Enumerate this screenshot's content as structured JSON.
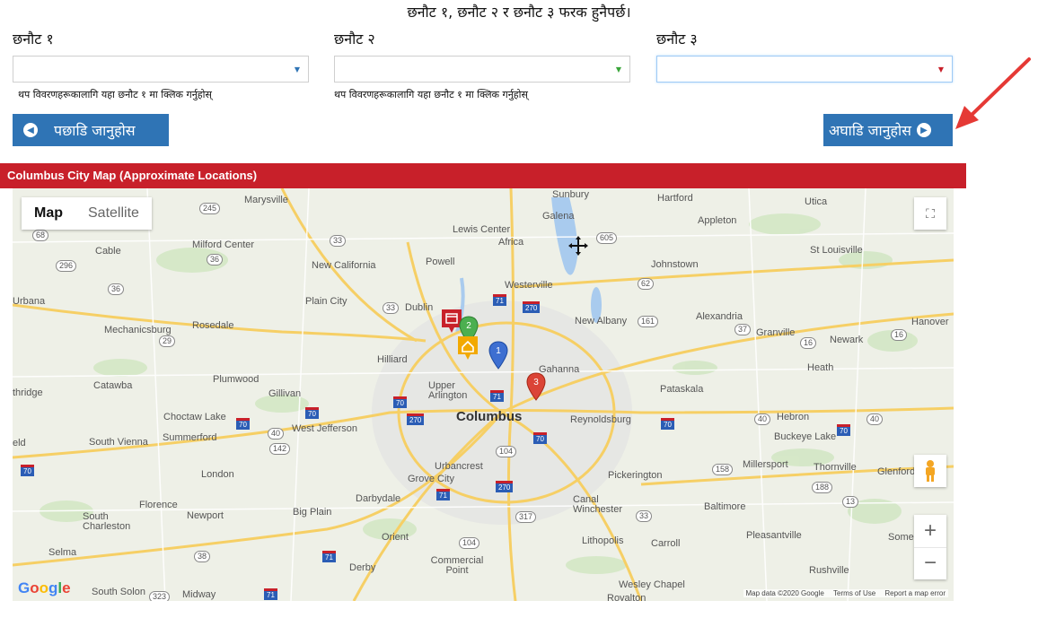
{
  "instruction": "छनौट १, छनौट २ र छनौट ३ फरक हुनैपर्छ।",
  "choices": [
    {
      "label": "छनौट १",
      "value": "",
      "helper": "थप विवरणहरूकालागि यहा छनौट १ मा क्लिक गर्नुहोस्",
      "caret_color": "#2f74b5"
    },
    {
      "label": "छनौट २",
      "value": "",
      "helper": "थप विवरणहरूकालागि यहा छनौट १ मा क्लिक गर्नुहोस्",
      "caret_color": "#3aa53a"
    },
    {
      "label": "छनौट ३",
      "value": "",
      "helper": "",
      "caret_color": "#c8202a"
    }
  ],
  "nav": {
    "back_label": "पछाडि जानुहोस",
    "next_label": "अघाडि जानुहोस"
  },
  "map": {
    "header": "Columbus City Map (Approximate Locations)",
    "type_map": "Map",
    "type_satellite": "Satellite",
    "logo": "Google",
    "footer": {
      "data": "Map data ©2020 Google",
      "terms": "Terms of Use",
      "report": "Report a map error"
    },
    "city": "Columbus",
    "places": [
      "Marysville",
      "Sunbury",
      "Hartford",
      "Utica",
      "Lewis Center",
      "Galena",
      "Appleton",
      "Africa",
      "Milford Center",
      "Cable",
      "New California",
      "Powell",
      "Johnstown",
      "St Louisville",
      "Westerville",
      "Urbana",
      "Plain City",
      "Dublin",
      "New Albany",
      "Alexandria",
      "Hanover",
      "Mechanicsburg",
      "Rosedale",
      "Granville",
      "Newark",
      "Hilliard",
      "Gahanna",
      "Heath",
      "Plumwood",
      "Catawba",
      "Gillivan",
      "Upper Arlington",
      "Pataskala",
      "Choctaw Lake",
      "Reynoldsburg",
      "Hebron",
      "South Vienna",
      "Summerford",
      "West Jefferson",
      "Buckeye Lake",
      "London",
      "Urbancrest",
      "Grove City",
      "Pickerington",
      "Millersport",
      "Thornville",
      "Glenford",
      "Darbydale",
      "Florence",
      "South Charleston",
      "Newport",
      "Big Plain",
      "Canal Winchester",
      "Baltimore",
      "Orient",
      "Lithopolis",
      "Carroll",
      "Pleasantville",
      "Selma",
      "Derby",
      "Commercial Point",
      "Rushville",
      "South Solon",
      "Midway",
      "Wesley Chapel",
      "Royalton",
      "thridge",
      "eld",
      "Some"
    ],
    "markers": [
      "1",
      "2",
      "3"
    ],
    "marker_colors": {
      "m1": "#3d6fd1",
      "m2": "#4caf50",
      "m3": "#db4437",
      "home": "#f2a900",
      "store": "#c8202a"
    }
  }
}
